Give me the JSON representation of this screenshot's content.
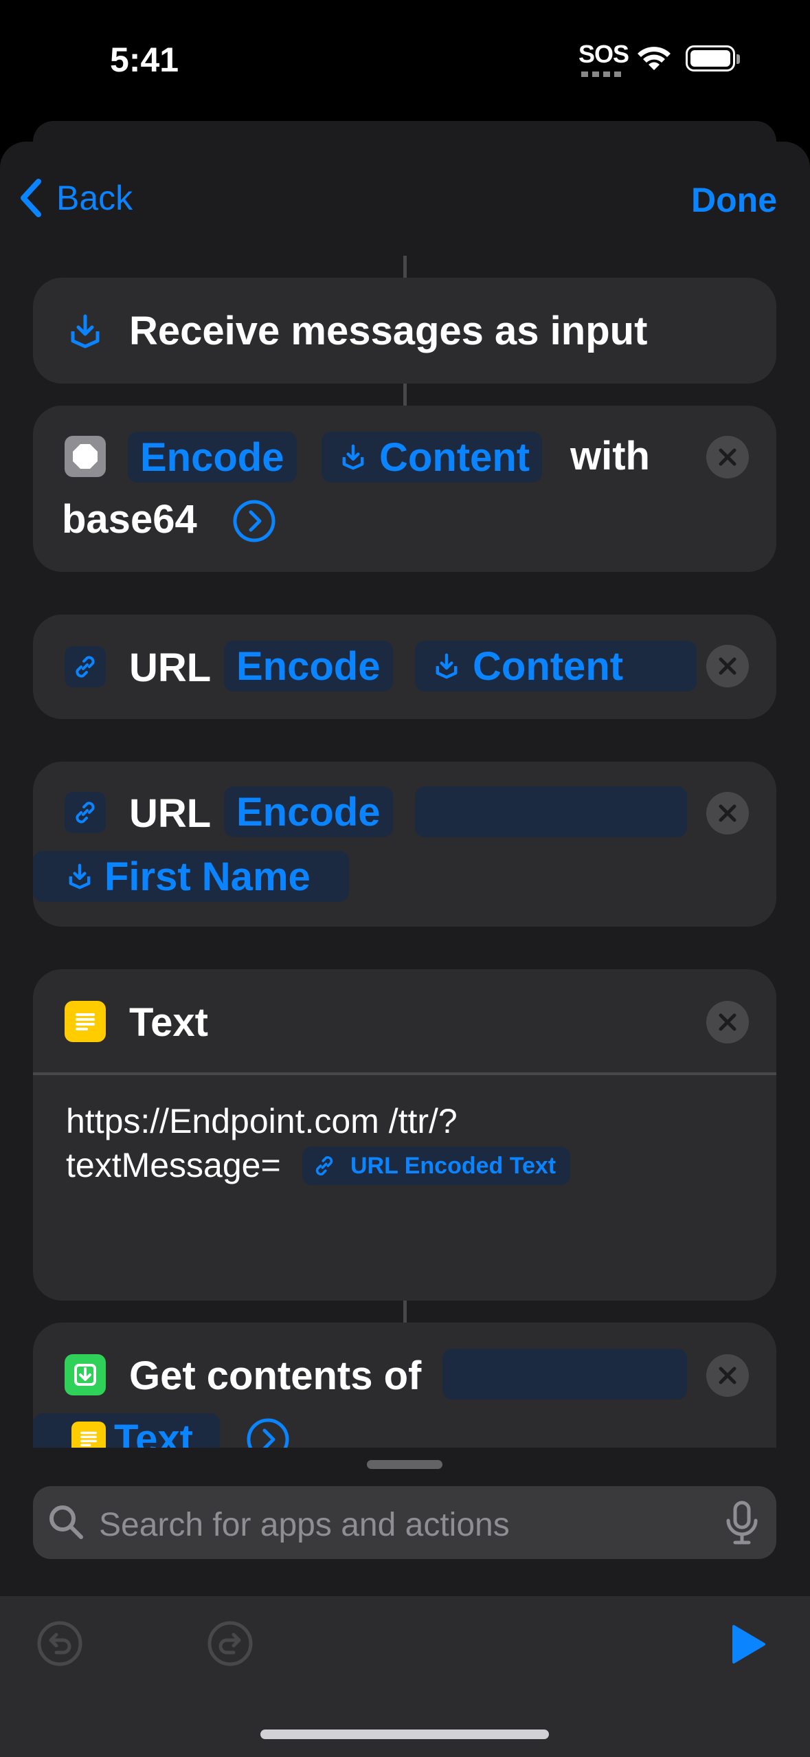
{
  "status_bar": {
    "time": "5:41",
    "sos": "SOS"
  },
  "nav": {
    "back_label": "Back",
    "done_label": "Done"
  },
  "actions": [
    {
      "title": "Receive messages as input"
    },
    {
      "encode": "Encode",
      "content": "Content",
      "with": "with",
      "format": "base64"
    },
    {
      "url": "URL",
      "encode": "Encode",
      "content": "Content"
    },
    {
      "url": "URL",
      "encode": "Encode",
      "variable": "First Name"
    },
    {
      "title": "Text",
      "line1": "https://Endpoint.com /ttr/?",
      "line2_prefix": "textMessage=",
      "variable": "URL Encoded Text"
    },
    {
      "title": "Get contents of",
      "variable": "Text"
    }
  ],
  "search": {
    "placeholder": "Search for apps and actions"
  },
  "icons": {
    "back": "chevron-left-icon",
    "receive": "shortcut-input-icon",
    "stop": "stop-icon",
    "link": "link-icon",
    "text": "text-lines-icon",
    "download": "download-icon",
    "remove": "xmark-circle-icon",
    "more": "chevron-right-circle-icon",
    "search": "magnifyingglass-icon",
    "mic": "microphone-icon",
    "undo": "undo-icon",
    "redo": "redo-icon",
    "play": "play-icon"
  },
  "colors": {
    "accent": "#0a84ff",
    "text_icon": "#ffcc00",
    "download_icon": "#30d158",
    "card": "#2c2c2e"
  }
}
